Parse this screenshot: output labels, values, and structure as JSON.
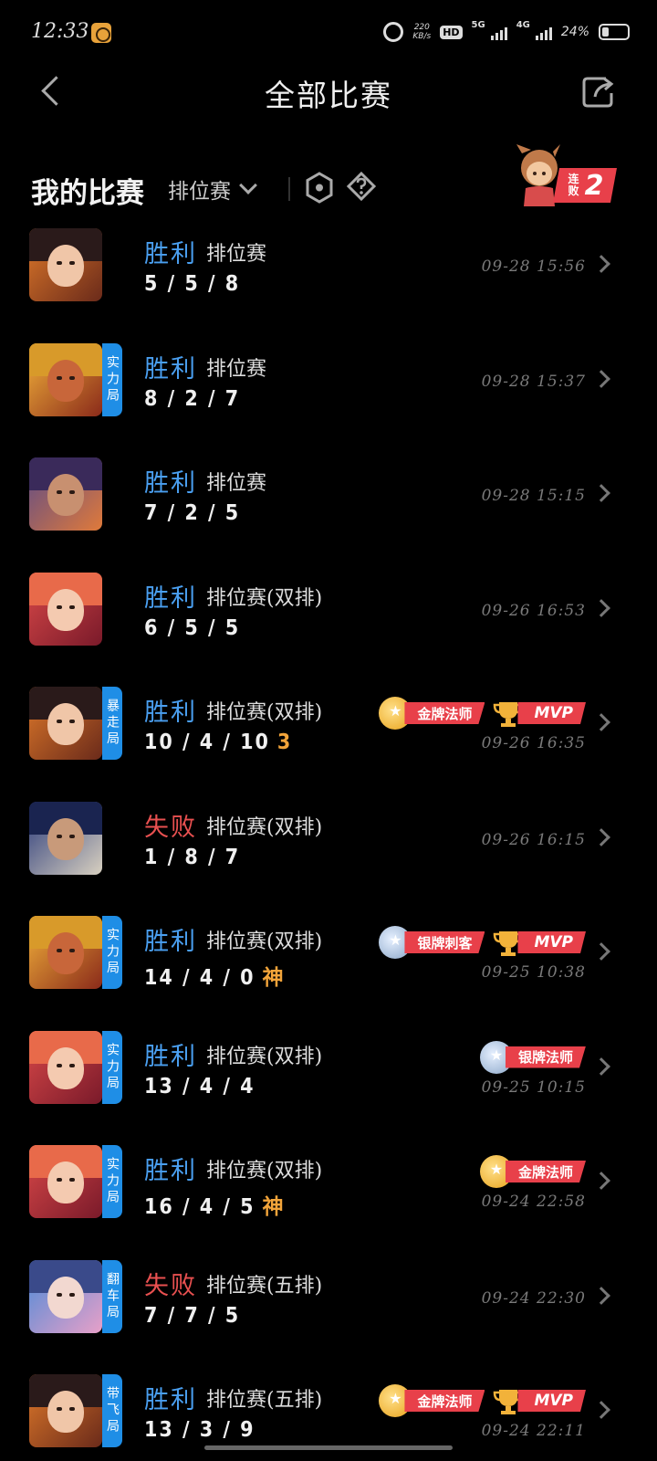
{
  "status_bar": {
    "time": "12:33",
    "net_speed": "220\nKB/s",
    "hd": "HD",
    "net_5g": "5G",
    "net_4g": "4G",
    "battery_pct": "24%",
    "battery_level": 0.24
  },
  "header": {
    "title": "全部比赛"
  },
  "filter": {
    "section_title": "我的比赛",
    "mode": "排位赛",
    "streak_label": "连败",
    "streak_count": "2"
  },
  "colors": {
    "win": "#4a9ff0",
    "lose": "#e85050",
    "tag": "#1f8ee6",
    "badge": "#e8404a",
    "extra": "#f2a43a"
  },
  "matches": [
    {
      "result": "胜利",
      "mode": "排位赛",
      "kda": "5 / 5 / 8",
      "extra": "",
      "time": "09-28 15:56",
      "tag": "",
      "badges": [],
      "hero": "hero-a"
    },
    {
      "result": "胜利",
      "mode": "排位赛",
      "kda": "8 / 2 / 7",
      "extra": "",
      "time": "09-28 15:37",
      "tag": "实力局",
      "badges": [],
      "hero": "hero-b"
    },
    {
      "result": "胜利",
      "mode": "排位赛",
      "kda": "7 / 2 / 5",
      "extra": "",
      "time": "09-28 15:15",
      "tag": "",
      "badges": [],
      "hero": "hero-c"
    },
    {
      "result": "胜利",
      "mode": "排位赛(双排)",
      "kda": "6 / 5 / 5",
      "extra": "",
      "time": "09-26 16:53",
      "tag": "",
      "badges": [],
      "hero": "hero-d"
    },
    {
      "result": "胜利",
      "mode": "排位赛(双排)",
      "kda": "10 / 4 / 10",
      "extra": "3",
      "time": "09-26 16:35",
      "tag": "暴走局",
      "badges": [
        {
          "kind": "gold",
          "label": "金牌法师"
        },
        {
          "kind": "mvp",
          "label": "MVP"
        }
      ],
      "hero": "hero-a"
    },
    {
      "result": "失败",
      "mode": "排位赛(双排)",
      "kda": "1 / 8 / 7",
      "extra": "",
      "time": "09-26 16:15",
      "tag": "",
      "badges": [],
      "hero": "hero-e"
    },
    {
      "result": "胜利",
      "mode": "排位赛(双排)",
      "kda": "14 / 4 / 0",
      "extra": "神",
      "time": "09-25 10:38",
      "tag": "实力局",
      "badges": [
        {
          "kind": "silver",
          "label": "银牌刺客"
        },
        {
          "kind": "mvp",
          "label": "MVP"
        }
      ],
      "hero": "hero-b"
    },
    {
      "result": "胜利",
      "mode": "排位赛(双排)",
      "kda": "13 / 4 / 4",
      "extra": "",
      "time": "09-25 10:15",
      "tag": "实力局",
      "badges": [
        {
          "kind": "silver",
          "label": "银牌法师"
        }
      ],
      "hero": "hero-d"
    },
    {
      "result": "胜利",
      "mode": "排位赛(双排)",
      "kda": "16 / 4 / 5",
      "extra": "神",
      "time": "09-24 22:58",
      "tag": "实力局",
      "badges": [
        {
          "kind": "gold",
          "label": "金牌法师"
        }
      ],
      "hero": "hero-d"
    },
    {
      "result": "失败",
      "mode": "排位赛(五排)",
      "kda": "7 / 7 / 5",
      "extra": "",
      "time": "09-24 22:30",
      "tag": "翻车局",
      "badges": [],
      "hero": "hero-f"
    },
    {
      "result": "胜利",
      "mode": "排位赛(五排)",
      "kda": "13 / 3 / 9",
      "extra": "",
      "time": "09-24 22:11",
      "tag": "带飞局",
      "badges": [
        {
          "kind": "gold",
          "label": "金牌法师"
        },
        {
          "kind": "mvp",
          "label": "MVP"
        }
      ],
      "hero": "hero-a"
    }
  ]
}
